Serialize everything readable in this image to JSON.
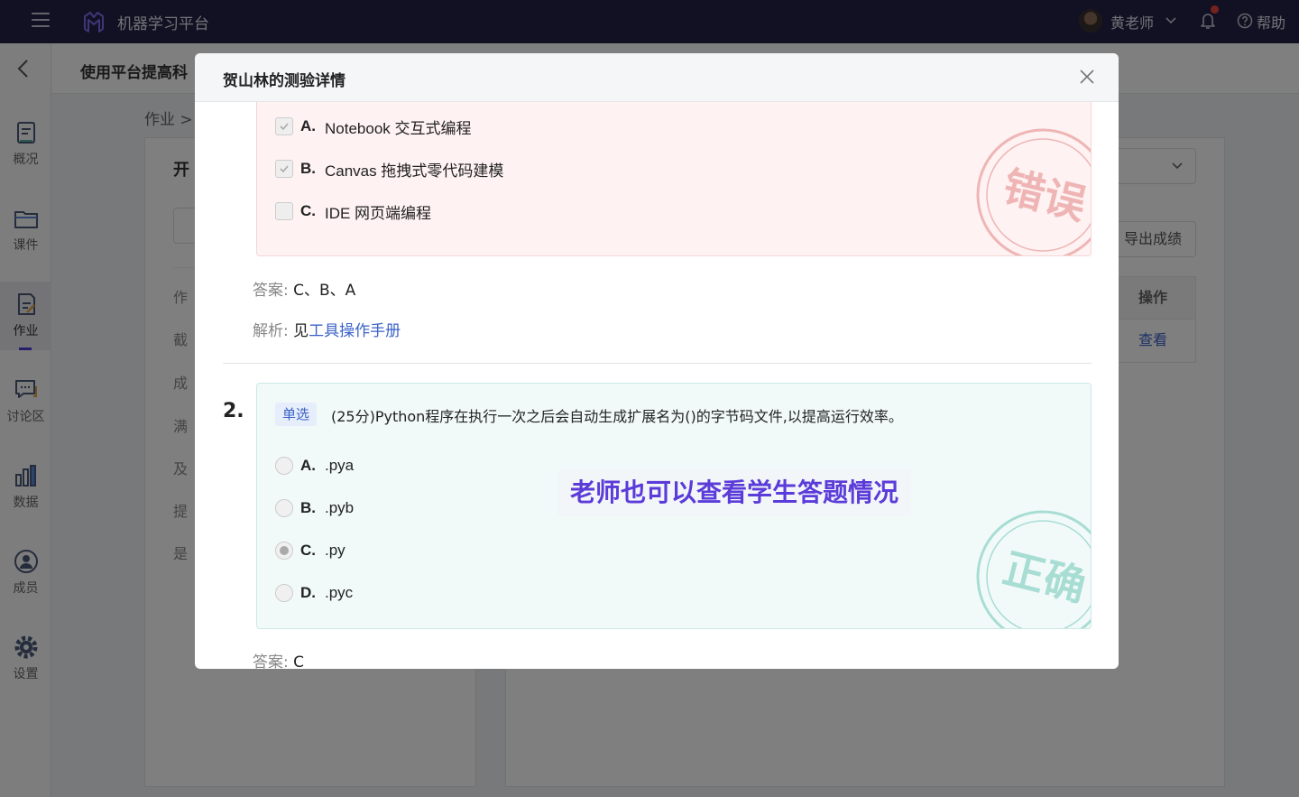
{
  "topbar": {
    "app_title": "机器学习平台",
    "user_name": "黄老师",
    "help_label": "帮助"
  },
  "sidebar": {
    "items": [
      {
        "label": "概况",
        "icon": "overview-icon"
      },
      {
        "label": "课件",
        "icon": "courseware-icon"
      },
      {
        "label": "作业",
        "icon": "homework-icon"
      },
      {
        "label": "讨论区",
        "icon": "discussion-icon"
      },
      {
        "label": "数据",
        "icon": "data-icon"
      },
      {
        "label": "成员",
        "icon": "member-icon"
      },
      {
        "label": "设置",
        "icon": "settings-icon"
      }
    ],
    "active_index": 2
  },
  "background": {
    "page_title": "使用平台提高科",
    "breadcrumb": "作业 >",
    "left_title": "开",
    "fields": [
      "作",
      "截",
      "成",
      "满",
      "及",
      "提",
      "是"
    ],
    "export_label": "导出成绩",
    "table_header": "操作",
    "table_action": "查看"
  },
  "modal": {
    "title": "贺山林的测验详情",
    "question1": {
      "options": [
        {
          "letter": "A.",
          "text": "Notebook 交互式编程",
          "checked": true
        },
        {
          "letter": "B.",
          "text": "Canvas 拖拽式零代码建模",
          "checked": true
        },
        {
          "letter": "C.",
          "text": "IDE 网页端编程",
          "checked": false
        }
      ],
      "stamp": "错误",
      "answer_label": "答案:",
      "answer": "C、B、A",
      "analysis_label": "解析:",
      "analysis_prefix": "见",
      "analysis_link": "工具操作手册"
    },
    "question2": {
      "number": "2.",
      "type_tag": "单选",
      "text": "(25分)Python程序在执行一次之后会自动生成扩展名为()的字节码文件,以提高运行效率。",
      "options": [
        {
          "letter": "A.",
          "text": ".pya",
          "selected": false
        },
        {
          "letter": "B.",
          "text": ".pyb",
          "selected": false
        },
        {
          "letter": "C.",
          "text": ".py",
          "selected": true
        },
        {
          "letter": "D.",
          "text": ".pyc",
          "selected": false
        }
      ],
      "stamp": "正确",
      "answer_label": "答案:",
      "answer": "C"
    },
    "callout": "老师也可以查看学生答题情况"
  },
  "colors": {
    "topbar": "#252347",
    "accent": "#4b3fd6",
    "link": "#3b62c8",
    "wrong_stamp": "#e8a0a0",
    "right_stamp": "#9bd6cc",
    "callout_text": "#5b3bd9"
  }
}
